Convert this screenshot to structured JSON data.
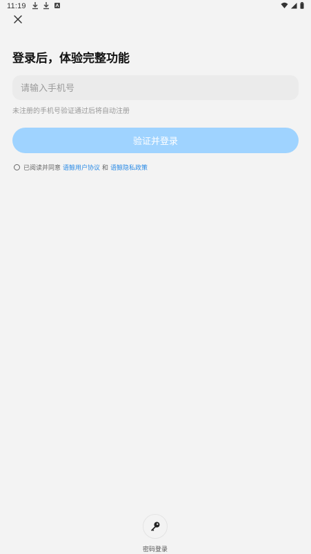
{
  "status_bar": {
    "time": "11:19"
  },
  "login": {
    "title": "登录后，体验完整功能",
    "phone_placeholder": "请输入手机号",
    "phone_value": "",
    "hint": "未注册的手机号验证通过后将自动注册",
    "login_button": "验证并登录"
  },
  "agreement": {
    "prefix": "已阅读并同意",
    "user_agreement": "语鲸用户协议",
    "and": "和",
    "privacy_policy": "语鲸隐私政策"
  },
  "password_login": {
    "label": "密码登录"
  },
  "colors": {
    "background": "#f3f3f3",
    "input_bg": "#ebebeb",
    "button_bg": "#9fd3ff",
    "link": "#2b8be6"
  }
}
